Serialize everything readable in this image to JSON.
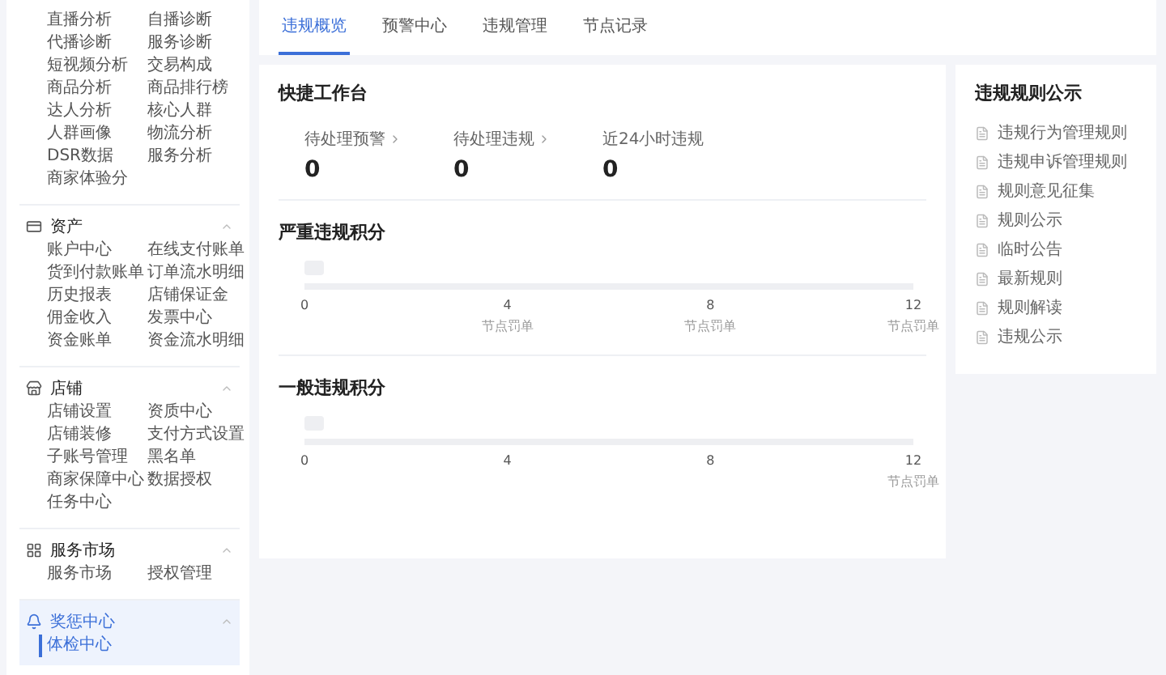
{
  "sidebar": {
    "sections": [
      {
        "items": [
          {
            "label": "直播分析",
            "selected": false
          },
          {
            "label": "自播诊断",
            "selected": false
          },
          {
            "label": "代播诊断",
            "selected": false
          },
          {
            "label": "服务诊断",
            "selected": false
          },
          {
            "label": "短视频分析",
            "selected": false
          },
          {
            "label": "交易构成",
            "selected": false
          },
          {
            "label": "商品分析",
            "selected": false
          },
          {
            "label": "商品排行榜",
            "selected": false
          },
          {
            "label": "达人分析",
            "selected": false
          },
          {
            "label": "核心人群",
            "selected": false
          },
          {
            "label": "人群画像",
            "selected": false
          },
          {
            "label": "物流分析",
            "selected": false
          },
          {
            "label": "DSR数据",
            "selected": false
          },
          {
            "label": "服务分析",
            "selected": false
          },
          {
            "label": "商家体验分",
            "selected": false
          }
        ]
      },
      {
        "title": "资产",
        "kind": "card",
        "expanded": true,
        "selected": false,
        "items": [
          {
            "label": "账户中心",
            "selected": false
          },
          {
            "label": "在线支付账单",
            "selected": false
          },
          {
            "label": "货到付款账单",
            "selected": false
          },
          {
            "label": "订单流水明细",
            "selected": false
          },
          {
            "label": "历史报表",
            "selected": false
          },
          {
            "label": "店铺保证金",
            "selected": false
          },
          {
            "label": "佣金收入",
            "selected": false
          },
          {
            "label": "发票中心",
            "selected": false
          },
          {
            "label": "资金账单",
            "selected": false
          },
          {
            "label": "资金流水明细",
            "selected": false
          }
        ]
      },
      {
        "title": "店铺",
        "kind": "shop",
        "expanded": true,
        "selected": false,
        "items": [
          {
            "label": "店铺设置",
            "selected": false
          },
          {
            "label": "资质中心",
            "selected": false
          },
          {
            "label": "店铺装修",
            "selected": false
          },
          {
            "label": "支付方式设置",
            "selected": false
          },
          {
            "label": "子账号管理",
            "selected": false
          },
          {
            "label": "黑名单",
            "selected": false
          },
          {
            "label": "商家保障中心",
            "selected": false
          },
          {
            "label": "数据授权",
            "selected": false
          },
          {
            "label": "任务中心",
            "selected": false
          }
        ]
      },
      {
        "title": "服务市场",
        "kind": "grid",
        "expanded": true,
        "selected": false,
        "items": [
          {
            "label": "服务市场",
            "selected": false
          },
          {
            "label": "授权管理",
            "selected": false
          }
        ]
      },
      {
        "title": "奖惩中心",
        "kind": "bell",
        "expanded": true,
        "selected": true,
        "items": [
          {
            "label": "体检中心",
            "selected": true
          }
        ]
      }
    ]
  },
  "tabs": [
    {
      "label": "违规概览",
      "selected": true
    },
    {
      "label": "预警中心",
      "selected": false
    },
    {
      "label": "违规管理",
      "selected": false
    },
    {
      "label": "节点记录",
      "selected": false
    }
  ],
  "workbench": {
    "title": "快捷工作台",
    "stats": [
      {
        "label": "待处理预警",
        "value": "0"
      },
      {
        "label": "待处理违规",
        "value": "0"
      },
      {
        "label": "近24小时违规",
        "value": "0"
      }
    ]
  },
  "scores": [
    {
      "title": "严重违规积分",
      "level": 0,
      "ticks": [
        {
          "value": "0"
        },
        {
          "value": "4",
          "note": "节点罚单"
        },
        {
          "value": "8",
          "note": "节点罚单"
        },
        {
          "value": "12",
          "note": "节点罚单"
        }
      ]
    },
    {
      "title": "一般违规积分",
      "level": 0,
      "ticks": [
        {
          "value": "0"
        },
        {
          "value": "4"
        },
        {
          "value": "8"
        },
        {
          "value": "12",
          "note": "节点罚单"
        }
      ]
    }
  ],
  "rules": {
    "title": "违规规则公示",
    "items": [
      "违规行为管理规则",
      "违规申诉管理规则",
      "规则意见征集",
      "规则公示",
      "临时公告",
      "最新规则",
      "规则解读",
      "违规公示"
    ]
  }
}
